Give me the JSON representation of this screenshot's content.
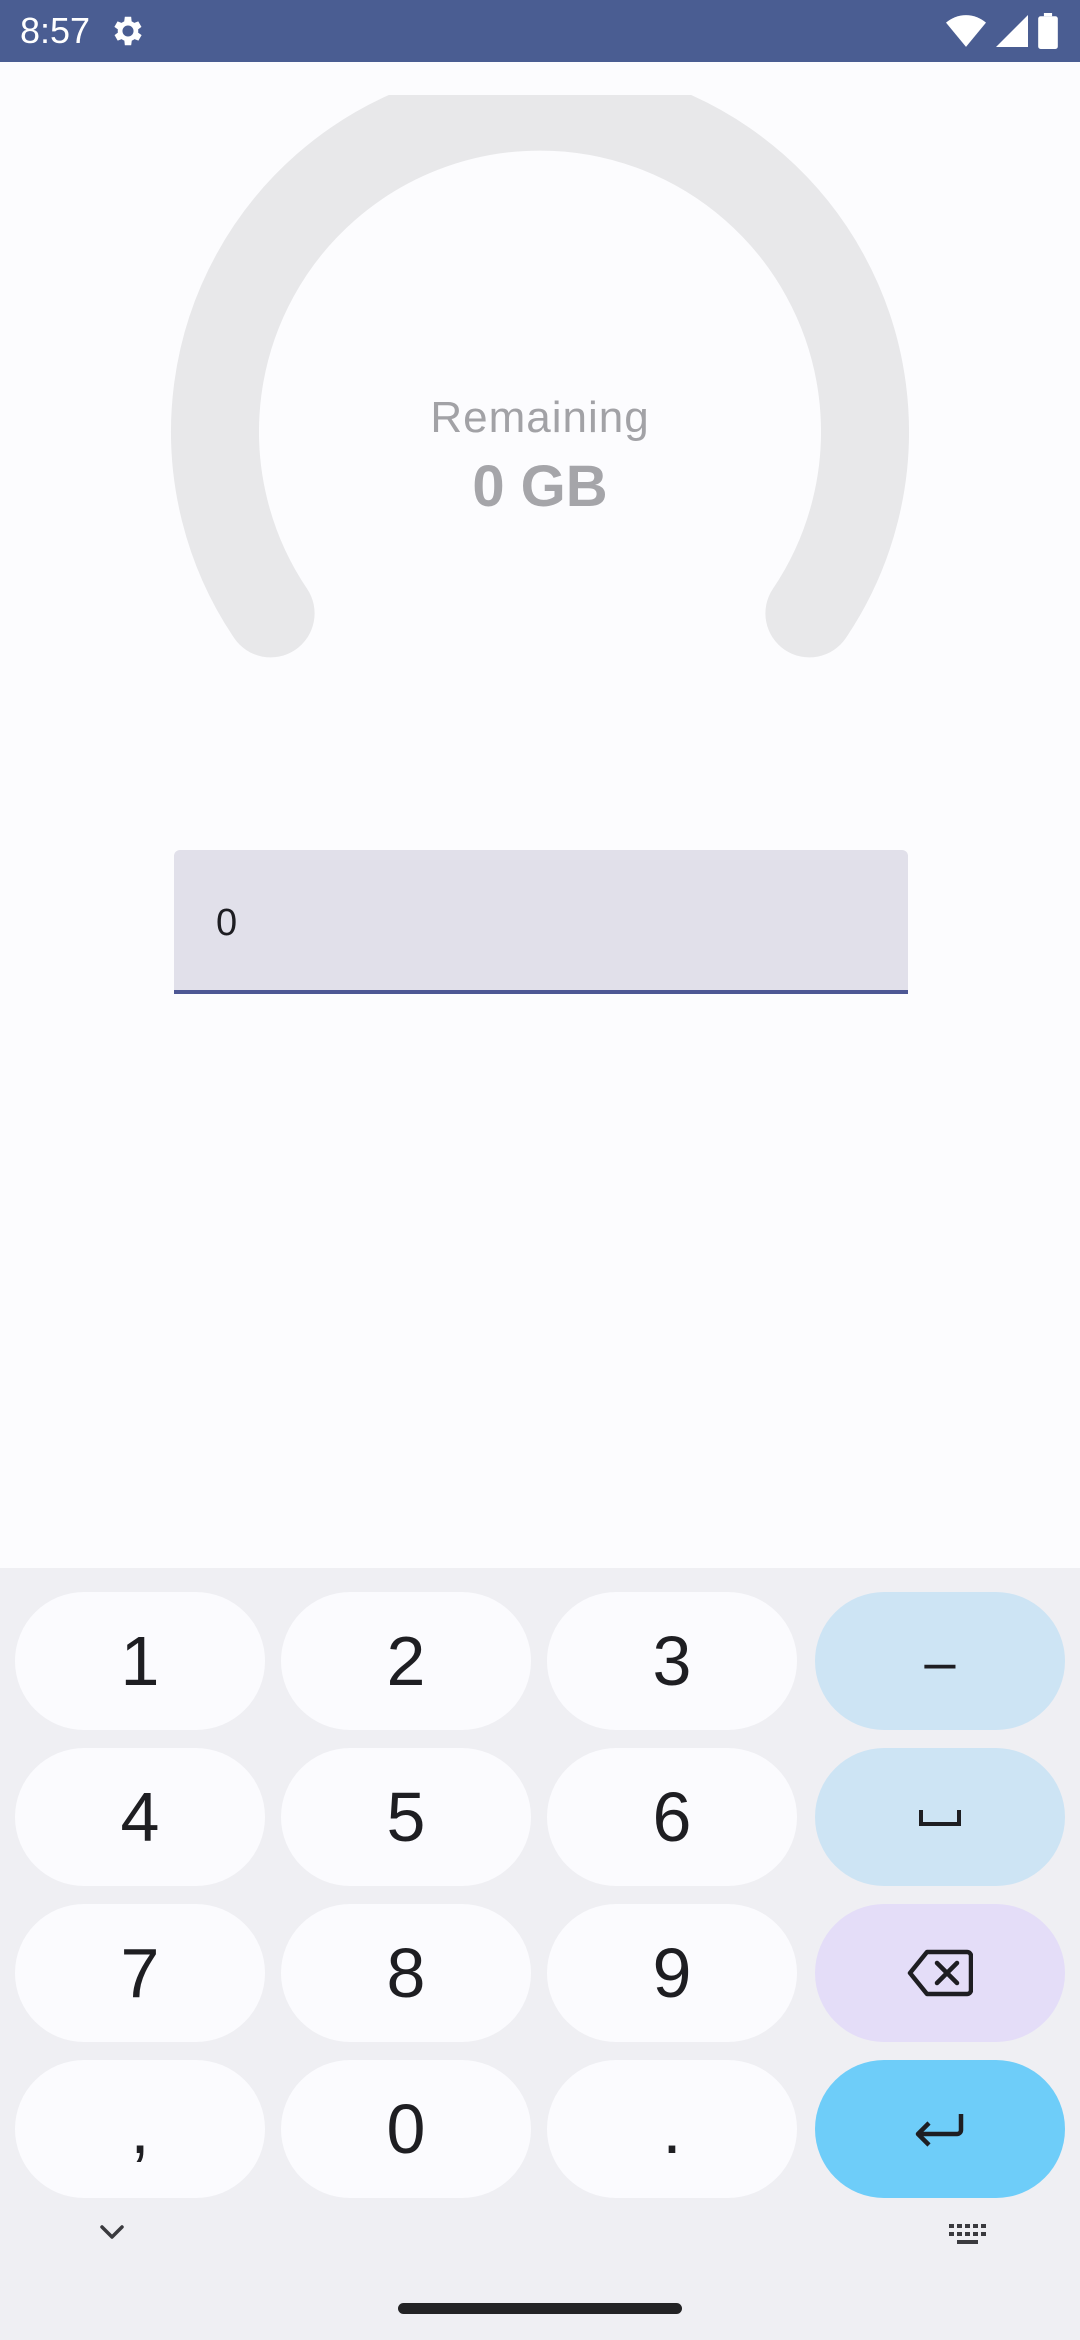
{
  "status_bar": {
    "time": "8:57",
    "icons": [
      "settings-icon",
      "wifi-icon",
      "cellular-signal-icon",
      "battery-icon"
    ]
  },
  "gauge": {
    "label": "Remaining",
    "value_text": "0 GB",
    "level": 0,
    "track_color": "#e8e8ea"
  },
  "input": {
    "value": "0"
  },
  "keyboard": {
    "rows": [
      [
        "1",
        "2",
        "3",
        "–"
      ],
      [
        "4",
        "5",
        "6",
        "space"
      ],
      [
        "7",
        "8",
        "9",
        "backspace"
      ],
      [
        ",",
        "0",
        ".",
        "enter"
      ]
    ],
    "keys": {
      "k1": "1",
      "k2": "2",
      "k3": "3",
      "minus": "–",
      "k4": "4",
      "k5": "5",
      "k6": "6",
      "k7": "7",
      "k8": "8",
      "k9": "9",
      "comma": ",",
      "k0": "0",
      "period": "."
    },
    "func_icons": [
      "space-icon",
      "backspace-icon",
      "enter-icon",
      "chevron-down-icon",
      "keyboard-icon"
    ]
  },
  "colors": {
    "status_bar": "#4a5d92",
    "input_background": "#e1e0ea",
    "input_underline": "#4d5794",
    "enter_key": "#6ecdf9",
    "function_key": "#cde4f4",
    "backspace_key": "#e4ddf8"
  }
}
